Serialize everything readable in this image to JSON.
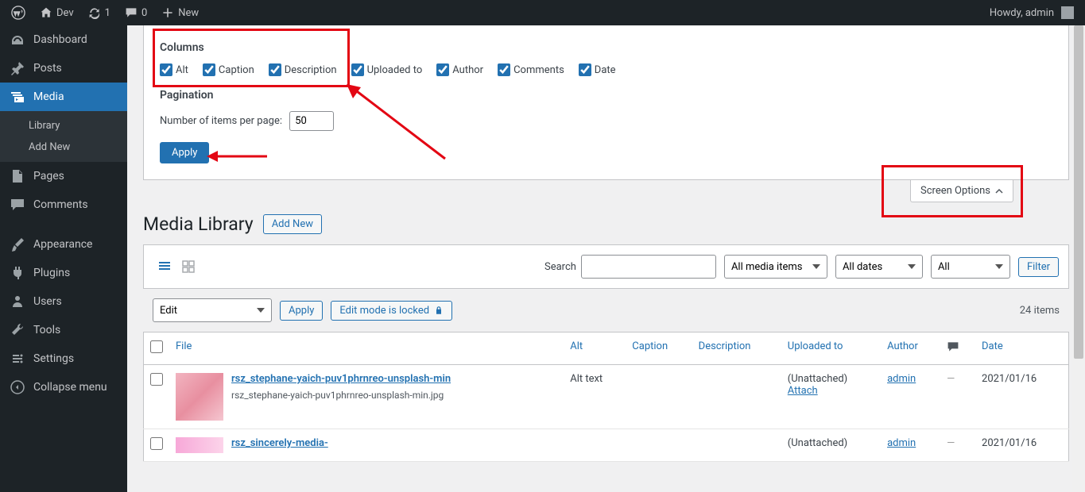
{
  "adminbar": {
    "site_name": "Dev",
    "refresh_count": "1",
    "comment_count": "0",
    "new_label": "New",
    "greeting": "Howdy, admin"
  },
  "sidebar": {
    "items": [
      {
        "icon": "dashboard",
        "label": "Dashboard"
      },
      {
        "icon": "pin",
        "label": "Posts"
      },
      {
        "icon": "media",
        "label": "Media",
        "current": true,
        "submenu": [
          "Library",
          "Add New"
        ]
      },
      {
        "icon": "page",
        "label": "Pages"
      },
      {
        "icon": "comment",
        "label": "Comments"
      },
      {
        "icon": "brush",
        "label": "Appearance"
      },
      {
        "icon": "plug",
        "label": "Plugins"
      },
      {
        "icon": "users",
        "label": "Users"
      },
      {
        "icon": "wrench",
        "label": "Tools"
      },
      {
        "icon": "settings",
        "label": "Settings"
      },
      {
        "icon": "collapse",
        "label": "Collapse menu"
      }
    ]
  },
  "screen_options": {
    "columns_label": "Columns",
    "columns": [
      {
        "label": "Alt",
        "checked": true
      },
      {
        "label": "Caption",
        "checked": true
      },
      {
        "label": "Description",
        "checked": true
      },
      {
        "label": "Uploaded to",
        "checked": true
      },
      {
        "label": "Author",
        "checked": true
      },
      {
        "label": "Comments",
        "checked": true
      },
      {
        "label": "Date",
        "checked": true
      }
    ],
    "pagination_label": "Pagination",
    "items_per_page_label": "Number of items per page:",
    "items_per_page_value": "50",
    "apply_label": "Apply",
    "tab_label": "Screen Options"
  },
  "page": {
    "title": "Media Library",
    "add_new": "Add New"
  },
  "filters": {
    "search_label": "Search",
    "media_type": "All media items",
    "dates": "All dates",
    "tags": "All",
    "filter_btn": "Filter"
  },
  "bulk": {
    "action": "Edit",
    "apply": "Apply",
    "edit_mode": "Edit mode is locked",
    "count": "24 items"
  },
  "table": {
    "headers": {
      "file": "File",
      "alt": "Alt",
      "caption": "Caption",
      "description": "Description",
      "uploaded_to": "Uploaded to",
      "author": "Author",
      "date": "Date"
    },
    "rows": [
      {
        "title": "rsz_stephane-yaich-puv1phrnreo-unsplash-min",
        "filename": "rsz_stephane-yaich-puv1phrnreo-unsplash-min.jpg",
        "alt": "Alt text",
        "caption": "",
        "description": "",
        "uploaded_to": "(Unattached)",
        "attach": "Attach",
        "author": "admin",
        "comments": "—",
        "date": "2021/01/16",
        "thumb_color": "#f2b4c0"
      },
      {
        "title": "rsz_sincerely-media-",
        "filename": "",
        "alt": "",
        "caption": "",
        "description": "",
        "uploaded_to": "(Unattached)",
        "attach": "",
        "author": "admin",
        "comments": "—",
        "date": "2021/01/16",
        "thumb_color": "#f7a8d8"
      }
    ]
  }
}
